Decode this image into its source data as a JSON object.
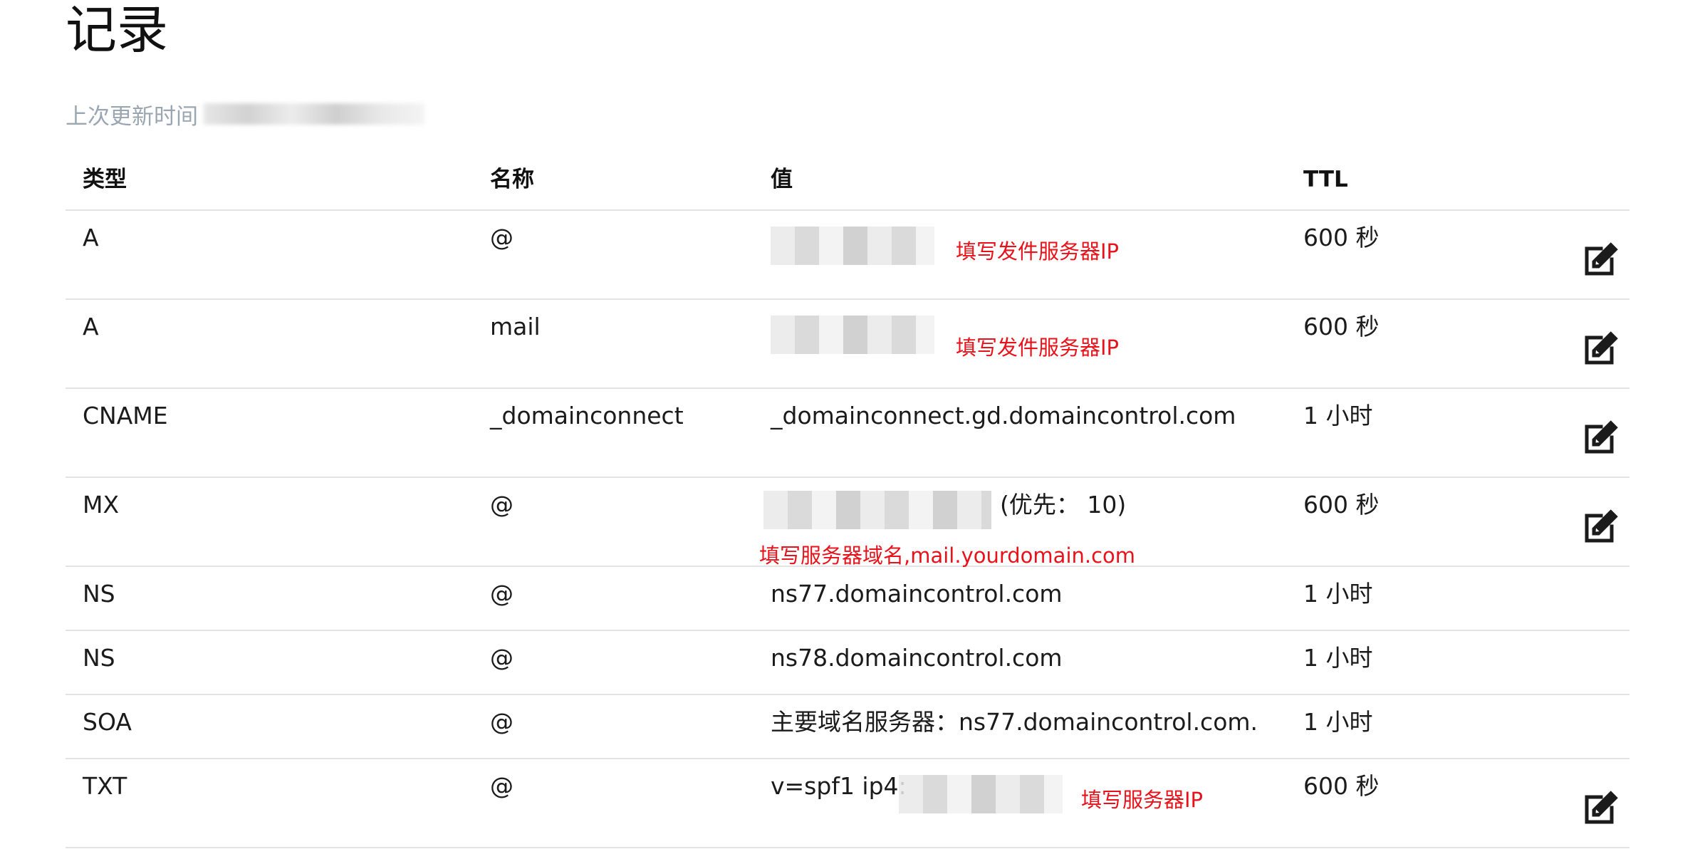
{
  "page": {
    "title": "记录",
    "updated_label": "上次更新时间"
  },
  "columns": {
    "type": "类型",
    "name": "名称",
    "value": "值",
    "ttl": "TTL"
  },
  "rows": [
    {
      "type": "A",
      "name": "@",
      "value": "",
      "ttl": "600 秒",
      "note": "填写发件服务器IP",
      "editable": true,
      "value_redacted": true
    },
    {
      "type": "A",
      "name": "mail",
      "value": "",
      "ttl": "600 秒",
      "note": "填写发件服务器IP",
      "editable": true,
      "value_redacted": true
    },
    {
      "type": "CNAME",
      "name": "_domainconnect",
      "value": "_domainconnect.gd.domaincontrol.com",
      "ttl": "1 小时",
      "editable": true
    },
    {
      "type": "MX",
      "name": "@",
      "value": "(优先： 10)",
      "ttl": "600 秒",
      "note": "填写服务器域名,mail.yourdomain.com",
      "editable": true,
      "value_redacted": true
    },
    {
      "type": "NS",
      "name": "@",
      "value": "ns77.domaincontrol.com",
      "ttl": "1 小时",
      "editable": false
    },
    {
      "type": "NS",
      "name": "@",
      "value": "ns78.domaincontrol.com",
      "ttl": "1 小时",
      "editable": false
    },
    {
      "type": "SOA",
      "name": "@",
      "value": "主要域名服务器：ns77.domaincontrol.com.",
      "ttl": "1 小时",
      "editable": false
    },
    {
      "type": "TXT",
      "name": "@",
      "value": "v=spf1 ip4:",
      "ttl": "600 秒",
      "note": "填写服务器IP",
      "editable": true,
      "value_redacted": true
    }
  ],
  "icons": {
    "edit": "edit-icon"
  },
  "colors": {
    "annotation": "#e8131a",
    "muted": "#9aa6b2",
    "divider": "#e3e3e3"
  }
}
